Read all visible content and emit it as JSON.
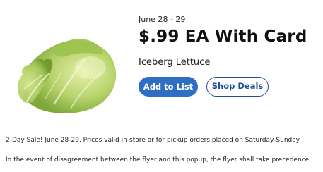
{
  "deal": {
    "date_range": "June 28 - 29",
    "price": "$.99 EA With Card",
    "product_name": "Iceberg Lettuce",
    "image_icon": "iceberg-lettuce-image"
  },
  "actions": {
    "add_to_list": "Add to List",
    "shop_deals": "Shop Deals",
    "primary_color": "#2e6fc4",
    "secondary_color": "#1f4f94"
  },
  "footnotes": {
    "sale_note": "2-Day Sale! June 28-29. Prices valid in-store or for pickup orders placed on Saturday-Sunday",
    "disclaimer": "In the event of disagreement between the flyer and this popup, the flyer shall take precedence."
  }
}
